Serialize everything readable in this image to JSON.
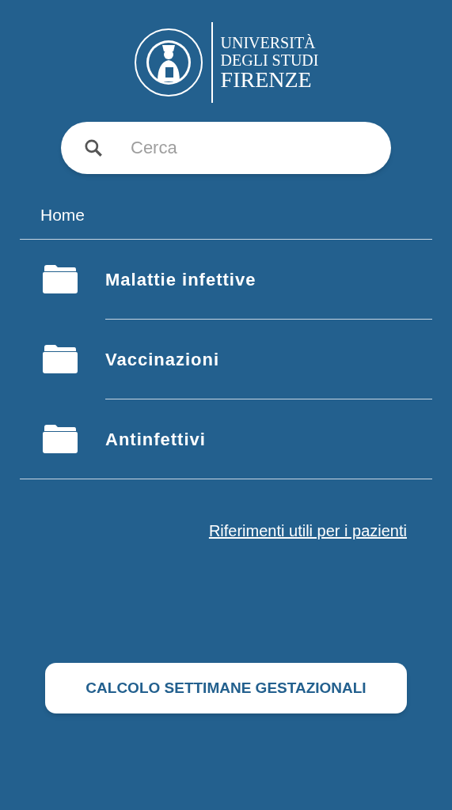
{
  "logo": {
    "lines": [
      "UNIVERSITÀ",
      "DEGLI STUDI",
      "FIRENZE"
    ]
  },
  "search": {
    "placeholder": "Cerca"
  },
  "breadcrumb": "Home",
  "folders": [
    {
      "label": "Malattie infettive"
    },
    {
      "label": "Vaccinazioni"
    },
    {
      "label": "Antinfettivi"
    }
  ],
  "link": "Riferimenti utili per i pazienti",
  "button": "CALCOLO SETTIMANE GESTAZIONALI"
}
